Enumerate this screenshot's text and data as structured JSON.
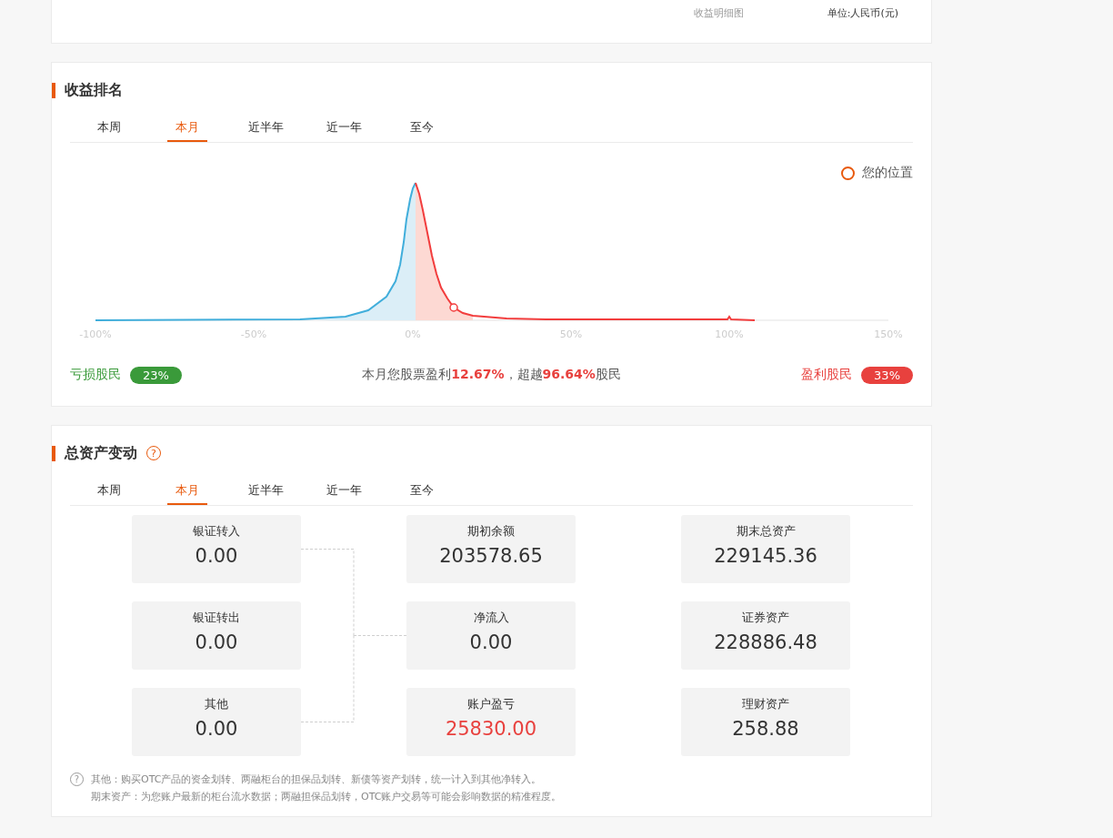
{
  "top_card": {
    "caption": "收益明细图",
    "unit": "单位:人民币(元)"
  },
  "ranking": {
    "title": "收益排名",
    "tabs": [
      {
        "label": "本周",
        "selected": false
      },
      {
        "label": "本月",
        "selected": true
      },
      {
        "label": "近半年",
        "selected": false
      },
      {
        "label": "近一年",
        "selected": false
      },
      {
        "label": "至今",
        "selected": false
      }
    ],
    "legend": "您的位置",
    "axis_labels": [
      "-100%",
      "-50%",
      "0%",
      "50%",
      "100%",
      "150%"
    ],
    "loss_label": "亏损股民",
    "loss_share": "23%",
    "summary": "本月您股票盈利**12.67%**，超越**96.64%**股民",
    "profit_label": "盈利股民",
    "profit_share": "33%"
  },
  "assets": {
    "title": "总资产变动",
    "help": "?",
    "tabs": [
      {
        "label": "本周",
        "selected": false
      },
      {
        "label": "本月",
        "selected": true
      },
      {
        "label": "近半年",
        "selected": false
      },
      {
        "label": "近一年",
        "selected": false
      },
      {
        "label": "至今",
        "selected": false
      }
    ],
    "columns": [
      [
        {
          "label": "银证转入",
          "value": "0.00",
          "kind": "plain"
        },
        {
          "label": "银证转出",
          "value": "0.00",
          "kind": "plain"
        },
        {
          "label": "其他",
          "value": "0.00",
          "kind": "plain"
        }
      ],
      [
        {
          "label": "期初余额",
          "value": "203578.65",
          "kind": "plain"
        },
        {
          "label": "净流入",
          "value": "0.00",
          "kind": "plain"
        },
        {
          "label": "账户盈亏",
          "value": "25830.00",
          "kind": "gain"
        }
      ],
      [
        {
          "label": "期末总资产",
          "value": "229145.36",
          "kind": "plain"
        },
        {
          "label": "证券资产",
          "value": "228886.48",
          "kind": "plain"
        },
        {
          "label": "理财资产",
          "value": "258.88",
          "kind": "plain"
        }
      ]
    ],
    "notes": [
      "其他：购买OTC产品的资金划转、两融柜台的担保品划转、新债等资产划转，统一计入到其他净转入。",
      "期末资产：为您账户最新的柜台流水数据；两融担保品划转，OTC账户交易等可能会影响数据的精准程度。"
    ]
  }
}
